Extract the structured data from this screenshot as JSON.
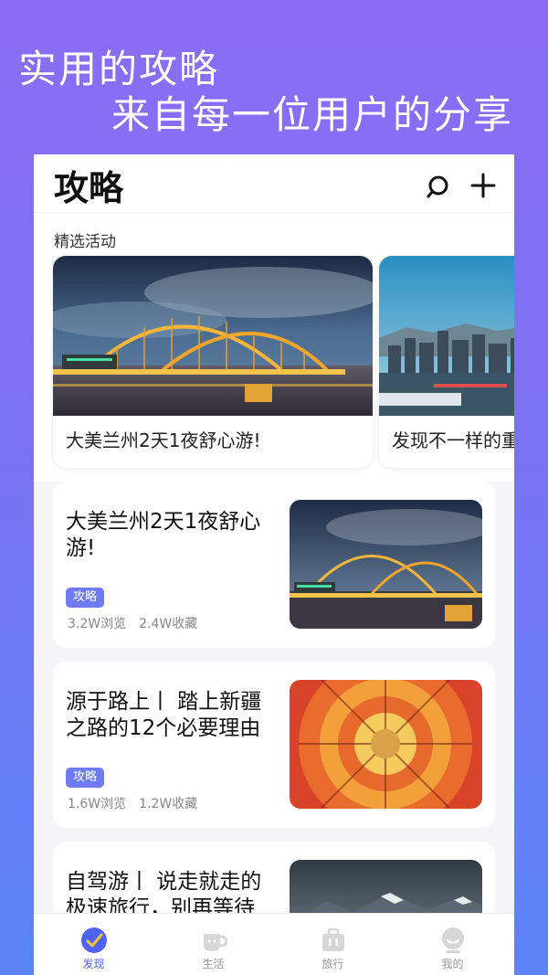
{
  "promo": {
    "line1": "实用的攻略",
    "line2": "来自每一位用户的分享"
  },
  "header": {
    "title": "攻略",
    "search_icon": "search-icon",
    "add_icon": "plus-icon"
  },
  "featured": {
    "label": "精选活动",
    "cards": [
      {
        "caption": "大美兰州2天1夜舒心游!"
      },
      {
        "caption": "发现不一样的重"
      }
    ]
  },
  "articles": [
    {
      "title": "大美兰州2天1夜舒心游!",
      "tag": "攻略",
      "views": "3.2W浏览",
      "favorites": "2.4W收藏"
    },
    {
      "title": "源于路上丨 踏上新疆之路的12个必要理由",
      "tag": "攻略",
      "views": "1.6W浏览",
      "favorites": "1.2W收藏"
    },
    {
      "title": "自驾游丨 说走就走的极速旅行，别再等待"
    }
  ],
  "tabs": [
    {
      "label": "发现",
      "icon": "discover-icon",
      "active": true
    },
    {
      "label": "生活",
      "icon": "cup-icon",
      "active": false
    },
    {
      "label": "旅行",
      "icon": "suitcase-icon",
      "active": false
    },
    {
      "label": "我的",
      "icon": "profile-icon",
      "active": false
    }
  ],
  "colors": {
    "accent": "#5063f0",
    "tag": "#6e7bf5",
    "bg_top": "#8b6cf5",
    "bg_bottom": "#5a84f8"
  }
}
